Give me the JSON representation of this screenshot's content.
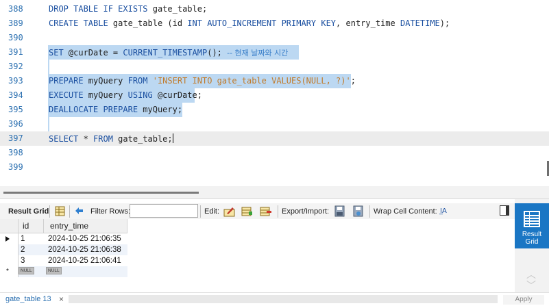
{
  "editor": {
    "lines": [
      {
        "n": "388",
        "segments": [
          {
            "t": "DROP TABLE IF EXISTS ",
            "c": "kw"
          },
          {
            "t": "gate_table;",
            "c": ""
          }
        ]
      },
      {
        "n": "389",
        "segments": [
          {
            "t": "CREATE TABLE ",
            "c": "kw"
          },
          {
            "t": "gate_table (id ",
            "c": ""
          },
          {
            "t": "INT AUTO_INCREMENT PRIMARY KEY",
            "c": "kw"
          },
          {
            "t": ", entry_time ",
            "c": ""
          },
          {
            "t": "DATETIME",
            "c": "kw"
          },
          {
            "t": ");",
            "c": ""
          }
        ]
      },
      {
        "n": "390",
        "segments": []
      },
      {
        "n": "391",
        "segments": [
          {
            "t": "SET ",
            "c": "kw"
          },
          {
            "t": "@curDate = ",
            "c": ""
          },
          {
            "t": "CURRENT_TIMESTAMP",
            "c": "kw"
          },
          {
            "t": "(); ",
            "c": ""
          },
          {
            "t": "-- 현재 날짜와 시간",
            "c": "cmt"
          }
        ]
      },
      {
        "n": "392",
        "segments": []
      },
      {
        "n": "393",
        "segments": [
          {
            "t": "PREPARE ",
            "c": "kw"
          },
          {
            "t": "myQuery ",
            "c": ""
          },
          {
            "t": "FROM ",
            "c": "kw"
          },
          {
            "t": "'INSERT INTO gate_table VALUES(NULL, ?)'",
            "c": "str"
          },
          {
            "t": ";",
            "c": ""
          }
        ]
      },
      {
        "n": "394",
        "segments": [
          {
            "t": "EXECUTE ",
            "c": "kw"
          },
          {
            "t": "myQuery ",
            "c": ""
          },
          {
            "t": "USING ",
            "c": "kw"
          },
          {
            "t": "@curDate;",
            "c": ""
          }
        ]
      },
      {
        "n": "395",
        "segments": [
          {
            "t": "DEALLOCATE PREPARE ",
            "c": "kw"
          },
          {
            "t": "myQuery;",
            "c": ""
          }
        ]
      },
      {
        "n": "396",
        "segments": []
      },
      {
        "n": "397",
        "segments": [
          {
            "t": "SELECT ",
            "c": "kw"
          },
          {
            "t": "* ",
            "c": ""
          },
          {
            "t": "FROM ",
            "c": "kw"
          },
          {
            "t": "gate_table;",
            "c": ""
          }
        ]
      },
      {
        "n": "398",
        "segments": []
      },
      {
        "n": "399",
        "segments": []
      }
    ]
  },
  "toolbar": {
    "result_grid": "Result Grid",
    "filter_rows": "Filter Rows:",
    "filter_value": "",
    "edit": "Edit:",
    "export_import": "Export/Import:",
    "wrap_cell": "Wrap Cell Content:",
    "wrap_icon_text": "I̲A"
  },
  "grid": {
    "columns": [
      "id",
      "entry_time"
    ],
    "rows": [
      {
        "id": "1",
        "entry_time": "2024-10-25 21:06:35"
      },
      {
        "id": "2",
        "entry_time": "2024-10-25 21:06:38"
      },
      {
        "id": "3",
        "entry_time": "2024-10-25 21:06:41"
      }
    ],
    "null_label": "NULL",
    "new_row_marker": "*"
  },
  "right_panel": {
    "result_grid_line1": "Result",
    "result_grid_line2": "Grid"
  },
  "bottom": {
    "tab": "gate_table 13",
    "close": "×",
    "apply": "Apply"
  },
  "colors": {
    "accent": "#1a76c4",
    "selection": "#bcd8f2",
    "keyword": "#1a4fa0",
    "string": "#c07a2a"
  }
}
